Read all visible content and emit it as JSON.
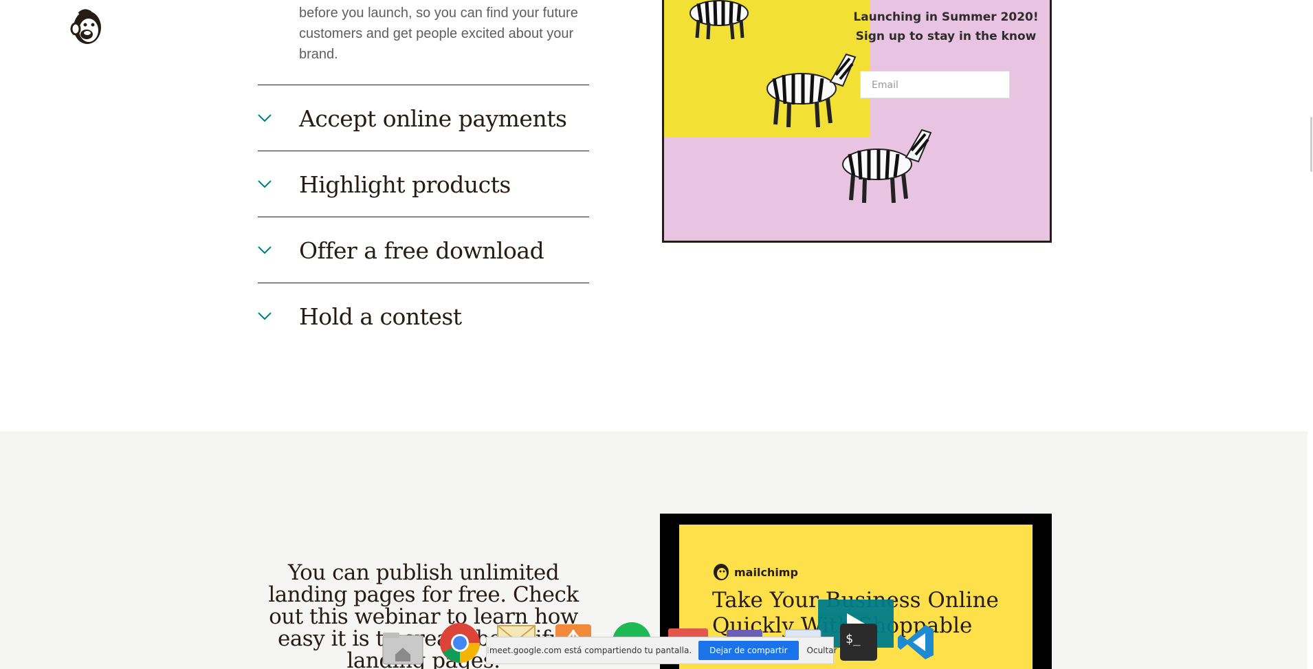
{
  "intro": {
    "text": "before you launch, so you can find your future customers and get people excited about your brand."
  },
  "accordion": {
    "items": [
      {
        "label": "Accept online payments"
      },
      {
        "label": "Highlight products"
      },
      {
        "label": "Offer a free download"
      },
      {
        "label": "Hold a contest"
      }
    ]
  },
  "promo": {
    "heading_line1": "Launching in Summer 2020!",
    "heading_line2": "Sign up to stay in the know",
    "email_placeholder": "Email"
  },
  "lower": {
    "text": "You can publish unlimited landing pages for free. Check out this webinar to learn how easy it is to create beautiful landing pages."
  },
  "video": {
    "brand": "mailchimp",
    "title": "Take Your Business Online Quickly With Shoppable"
  },
  "share_bar": {
    "message": "meet.google.com está compartiendo tu pantalla.",
    "stop_label": "Dejar de compartir",
    "hide_label": "Ocultar"
  },
  "dock": {
    "apps": [
      "home-folder-icon",
      "chrome-icon",
      "mail-icon",
      "presentation-icon",
      "spotify-icon",
      "app-red-icon",
      "app-purple-icon",
      "app-blue-icon",
      "terminal-icon",
      "vscode-icon"
    ]
  },
  "colors": {
    "accent_teal": "#007c89",
    "promo_pink": "#e8c4e2",
    "promo_yellow": "#f2e035",
    "video_yellow": "#fde04a",
    "share_blue": "#1a73e8"
  }
}
